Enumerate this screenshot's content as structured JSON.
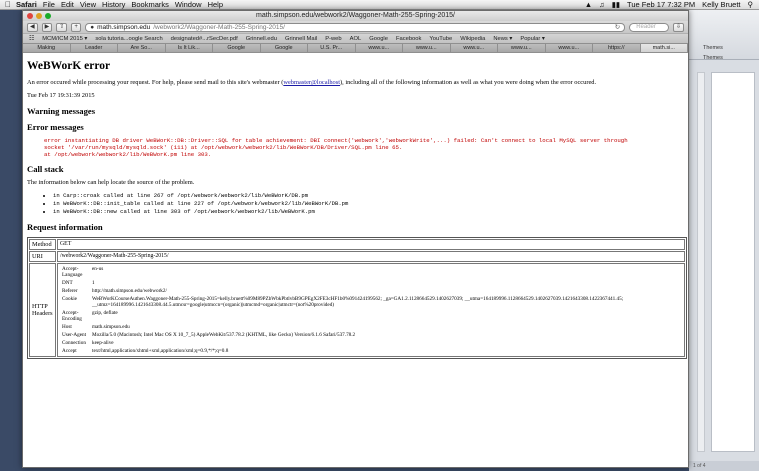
{
  "menubar": {
    "app": "Safari",
    "items": [
      "File",
      "Edit",
      "View",
      "History",
      "Bookmarks",
      "Window",
      "Help"
    ],
    "clock": "Tue Feb 17  7:32 PM",
    "user": "Kelly Bruett"
  },
  "window": {
    "title": "math.simpson.edu/webwork2/Waggoner-Math-255-Spring-2015/",
    "address_host": "math.simpson.edu",
    "address_path": "/webwork2/Waggoner-Math-255-Spring-2015/",
    "reader_label": "Reader"
  },
  "bookmarks": [
    "MCM/ICM 2015 ▾",
    "sola tutoria...oogle Search",
    "designated#...rSecDer.pdf",
    "Grinnell.edu",
    "Grinnell Mail",
    "P-web",
    "AOL",
    "Google",
    "Facebook",
    "YouTube",
    "Wikipedia",
    "News ▾",
    "Popular ▾"
  ],
  "tabs": [
    "Making",
    "Leader",
    "Are So...",
    "Is It Lik...",
    "Google",
    "Google",
    "U.S. Pr...",
    "www.u...",
    "www.u...",
    "www.u...",
    "www.u...",
    "www.u...",
    "https://",
    "math.si..."
  ],
  "page": {
    "title": "WeBWorK error",
    "intro_before": "An error occured while processing your request. For help, please send mail to this site's webmaster (",
    "email": "webmaster@localhost",
    "intro_after": "), including all of the following information as well as what you were doing when the error occured.",
    "timestamp": "Tue Feb 17 19:31:39 2015",
    "warning_heading": "Warning messages",
    "error_heading": "Error messages",
    "error_text": "error instantiating DB driver WeBWorK::DB::Driver::SQL for table achievement: DBI connect('webwork','webworkWrite',...) failed: Can't connect to local MySQL server through\nsocket '/var/run/mysqld/mysqld.sock' (111) at /opt/webwork/webwork2/lib/WeBWorK/DB/Driver/SQL.pm line 65.\nat /opt/webwork/webwork2/lib/WeBWorK.pm line 303.",
    "callstack_heading": "Call stack",
    "callstack_intro": "The information below can help locate the source of the problem.",
    "callstack": [
      "in Carp::croak called at line 267 of /opt/webwork/webwork2/lib/WeBWorK/DB.pm",
      "in WeBWorK::DB::init_table called at line 227 of /opt/webwork/webwork2/lib/WeBWorK/DB.pm",
      "in WeBWorK::DB::new called at line 303 of /opt/webwork/webwork2/lib/WeBWorK.pm"
    ],
    "request_heading": "Request information",
    "method_label": "Method",
    "method_value": "GET",
    "uri_label": "URI",
    "uri_value": "/webwork2/Waggoner-Math-255-Spring-2015/",
    "headers_label": "HTTP Headers",
    "headers": [
      {
        "k": "Accept-Language",
        "v": "en-us"
      },
      {
        "k": "DNT",
        "v": "1"
      },
      {
        "k": "Referer",
        "v": "http://math.simpson.edu/webwork2/"
      },
      {
        "k": "Cookie",
        "v": "WeBWorKCourseAuthen.Waggoner-Math-255-Spring-2015=kelly.bruett%09M89PZbWbkPbtlvbB9GPEgX2FE3cHF1b0%091424199562; _ga=GA1.2.1128664529.1402627039; __utma=164189996.1128664529.1402627039.1421643308.1422367441.45; __utmz=164189996.1421643308.44.5.utmcsr=google|utmccn=(organic)|utmcmd=organic|utmctr=(not%20provided)"
      },
      {
        "k": "Accept-Encoding",
        "v": "gzip, deflate"
      },
      {
        "k": "Host",
        "v": "math.simpson.edu"
      },
      {
        "k": "User-Agent",
        "v": "Mozilla/5.0 (Macintosh; Intel Mac OS X 10_7_5) AppleWebKit/537.78.2 (KHTML, like Gecko) Version/6.1.6 Safari/537.78.2"
      },
      {
        "k": "Connection",
        "v": "keep-alive"
      },
      {
        "k": "Accept",
        "v": "text/html,application/xhtml+xml,application/xml;q=0.9,*/*;q=0.8"
      }
    ]
  },
  "bgapp": {
    "themes_label": "Themes",
    "status": "1 of 4"
  },
  "colors": {
    "error_red": "#c00000",
    "link_blue": "#1a1aa6",
    "desktop": "#3a4a66"
  },
  "icons": [
    "apple-icon",
    "wifi-icon",
    "volume-icon",
    "battery-icon",
    "spotlight-icon",
    "back-icon",
    "forward-icon",
    "share-icon",
    "reload-icon",
    "bookmarks-icon",
    "downloads-icon"
  ]
}
